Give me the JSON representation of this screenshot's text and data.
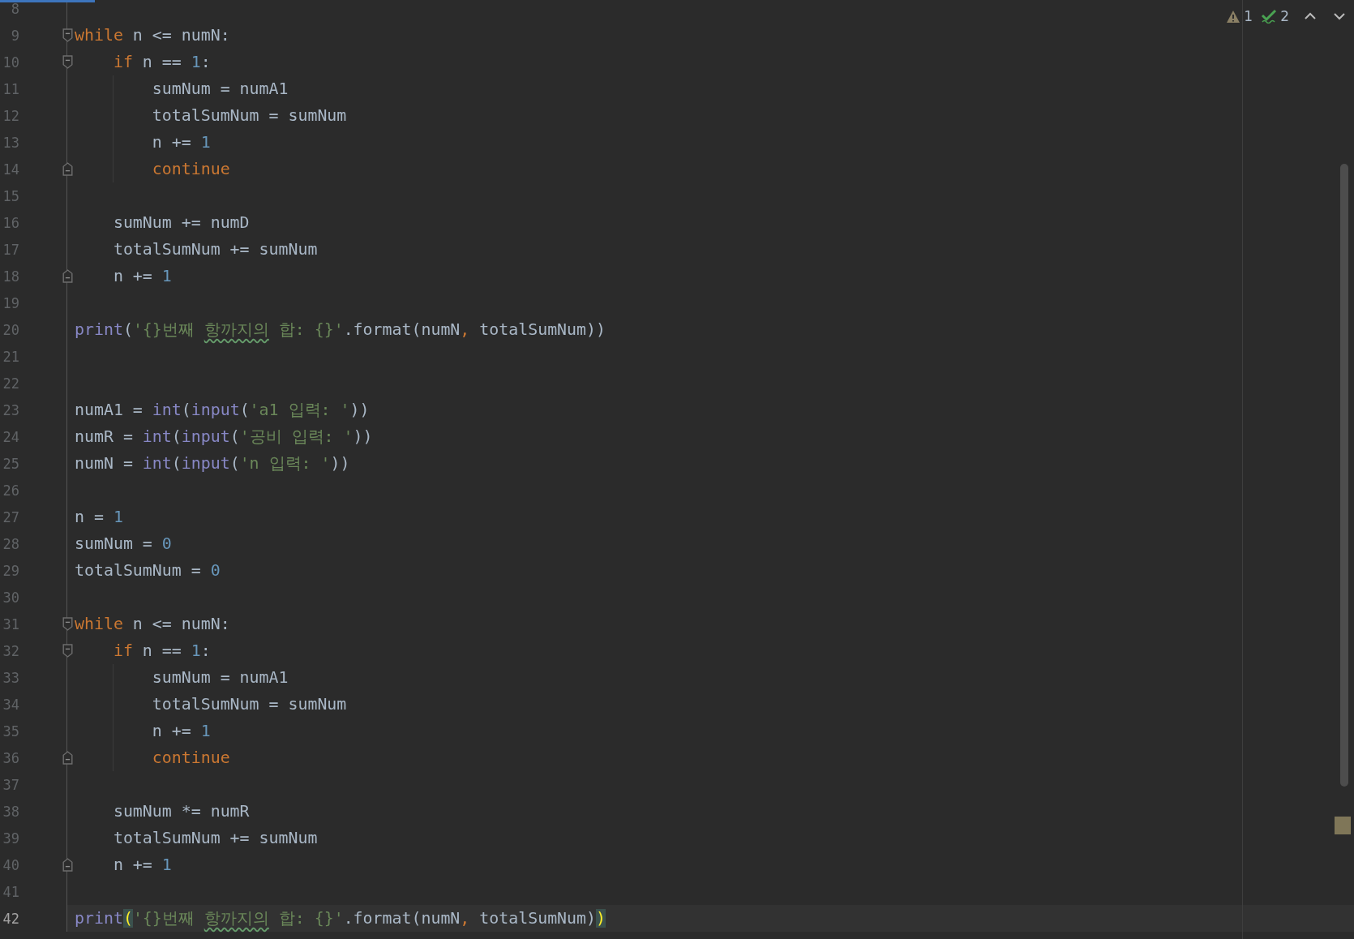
{
  "progress": {
    "level": 0.07
  },
  "inspections": {
    "warning_count": "1",
    "typo_count": "2"
  },
  "lines": [
    {
      "number": "8",
      "selected": false
    },
    {
      "number": "9",
      "selected": false,
      "fold_start": true,
      "tokens": [
        {
          "text": "while",
          "kind": "keyword"
        },
        {
          "text": " n <= numN:"
        }
      ]
    },
    {
      "number": "10",
      "selected": false,
      "fold_start": true,
      "tokens": [
        {
          "text": "    if",
          "kind": "keyword"
        },
        {
          "text": " n == "
        },
        {
          "text": "1",
          "kind": "number"
        },
        {
          "text": ":"
        }
      ]
    },
    {
      "number": "11",
      "selected": false,
      "tokens": [
        {
          "text": "        sumNum = numA1"
        }
      ]
    },
    {
      "number": "12",
      "selected": false,
      "tokens": [
        {
          "text": "        totalSumNum = sumNum"
        }
      ]
    },
    {
      "number": "13",
      "selected": false,
      "tokens": [
        {
          "text": "        n += "
        },
        {
          "text": "1",
          "kind": "number"
        }
      ]
    },
    {
      "number": "14",
      "selected": false,
      "fold_end": true,
      "tokens": [
        {
          "text": "        continue",
          "kind": "keyword"
        }
      ]
    },
    {
      "number": "15",
      "selected": false
    },
    {
      "number": "16",
      "selected": false,
      "tokens": [
        {
          "text": "    sumNum += numD"
        }
      ]
    },
    {
      "number": "17",
      "selected": false,
      "tokens": [
        {
          "text": "    totalSumNum += sumNum"
        }
      ]
    },
    {
      "number": "18",
      "selected": false,
      "fold_end": true,
      "tokens": [
        {
          "text": "    n += "
        },
        {
          "text": "1",
          "kind": "number"
        }
      ]
    },
    {
      "number": "19",
      "selected": false
    },
    {
      "number": "20",
      "selected": false,
      "tokens": [
        {
          "text": "print",
          "kind": "builtin"
        },
        {
          "text": "("
        },
        {
          "text": "'{}번째 ",
          "kind": "string"
        },
        {
          "text": "항까지의",
          "kind": "typo"
        },
        {
          "text": " 합: {}'",
          "kind": "string"
        },
        {
          "text": ".format(numN"
        },
        {
          "text": ",",
          "kind": "keyword"
        },
        {
          "text": " totalSumNum))"
        }
      ]
    },
    {
      "number": "21",
      "selected": false
    },
    {
      "number": "22",
      "selected": false
    },
    {
      "number": "23",
      "selected": false,
      "tokens": [
        {
          "text": "numA1 = "
        },
        {
          "text": "int",
          "kind": "builtin"
        },
        {
          "text": "("
        },
        {
          "text": "input",
          "kind": "builtin"
        },
        {
          "text": "("
        },
        {
          "text": "'a1 입력: '",
          "kind": "string"
        },
        {
          "text": "))"
        }
      ]
    },
    {
      "number": "24",
      "selected": false,
      "tokens": [
        {
          "text": "numR = "
        },
        {
          "text": "int",
          "kind": "builtin"
        },
        {
          "text": "("
        },
        {
          "text": "input",
          "kind": "builtin"
        },
        {
          "text": "("
        },
        {
          "text": "'공비 입력: '",
          "kind": "string"
        },
        {
          "text": "))"
        }
      ]
    },
    {
      "number": "25",
      "selected": false,
      "tokens": [
        {
          "text": "numN = "
        },
        {
          "text": "int",
          "kind": "builtin"
        },
        {
          "text": "("
        },
        {
          "text": "input",
          "kind": "builtin"
        },
        {
          "text": "("
        },
        {
          "text": "'n 입력: '",
          "kind": "string"
        },
        {
          "text": "))"
        }
      ]
    },
    {
      "number": "26",
      "selected": false
    },
    {
      "number": "27",
      "selected": false,
      "tokens": [
        {
          "text": "n = "
        },
        {
          "text": "1",
          "kind": "number"
        }
      ]
    },
    {
      "number": "28",
      "selected": false,
      "tokens": [
        {
          "text": "sumNum = "
        },
        {
          "text": "0",
          "kind": "number"
        }
      ]
    },
    {
      "number": "29",
      "selected": false,
      "tokens": [
        {
          "text": "totalSumNum = "
        },
        {
          "text": "0",
          "kind": "number"
        }
      ]
    },
    {
      "number": "30",
      "selected": false
    },
    {
      "number": "31",
      "selected": false,
      "fold_start": true,
      "tokens": [
        {
          "text": "while",
          "kind": "keyword"
        },
        {
          "text": " n <= numN:"
        }
      ]
    },
    {
      "number": "32",
      "selected": false,
      "fold_start": true,
      "tokens": [
        {
          "text": "    if",
          "kind": "keyword"
        },
        {
          "text": " n == "
        },
        {
          "text": "1",
          "kind": "number"
        },
        {
          "text": ":"
        }
      ]
    },
    {
      "number": "33",
      "selected": false,
      "tokens": [
        {
          "text": "        sumNum = numA1"
        }
      ]
    },
    {
      "number": "34",
      "selected": false,
      "tokens": [
        {
          "text": "        totalSumNum = sumNum"
        }
      ]
    },
    {
      "number": "35",
      "selected": false,
      "tokens": [
        {
          "text": "        n += "
        },
        {
          "text": "1",
          "kind": "number"
        }
      ]
    },
    {
      "number": "36",
      "selected": false,
      "fold_end": true,
      "tokens": [
        {
          "text": "        continue",
          "kind": "keyword"
        }
      ]
    },
    {
      "number": "37",
      "selected": false
    },
    {
      "number": "38",
      "selected": false,
      "tokens": [
        {
          "text": "    sumNum *= numR"
        }
      ]
    },
    {
      "number": "39",
      "selected": false,
      "tokens": [
        {
          "text": "    totalSumNum += sumNum"
        }
      ]
    },
    {
      "number": "40",
      "selected": false,
      "fold_end": true,
      "tokens": [
        {
          "text": "    n += "
        },
        {
          "text": "1",
          "kind": "number"
        }
      ]
    },
    {
      "number": "41",
      "selected": false
    },
    {
      "number": "42",
      "selected": true,
      "tokens": [
        {
          "text": "print",
          "kind": "builtin"
        },
        {
          "text": "(",
          "kind": "matched_paren"
        },
        {
          "text": "'{}번째 ",
          "kind": "string"
        },
        {
          "text": "항까지의",
          "kind": "typo"
        },
        {
          "text": " 합: {}'",
          "kind": "string"
        },
        {
          "text": ".format(numN"
        },
        {
          "text": ",",
          "kind": "keyword"
        },
        {
          "text": " totalSumNum)"
        },
        {
          "text": ")",
          "kind": "matched_paren"
        }
      ]
    }
  ]
}
